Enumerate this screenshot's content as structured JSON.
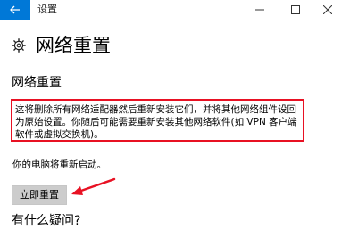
{
  "window": {
    "title": "设置"
  },
  "header": {
    "title": "网络重置",
    "icon": "gear-icon"
  },
  "section": {
    "heading": "网络重置",
    "description": "这将删除所有网络适配器然后重新安装它们，并将其他网络组件设回为原始设置。你随后可能需要重新安装其他网络软件(如 VPN 客户端软件或虚拟交换机)。",
    "restart_note": "你的电脑将重新启动。",
    "reset_button_label": "立即重置"
  },
  "help": {
    "heading": "有什么疑问?"
  },
  "colors": {
    "accent": "#0078d7",
    "highlight_border": "#e81123",
    "annotation_arrow": "#e81123",
    "button_bg": "#cccccc"
  }
}
